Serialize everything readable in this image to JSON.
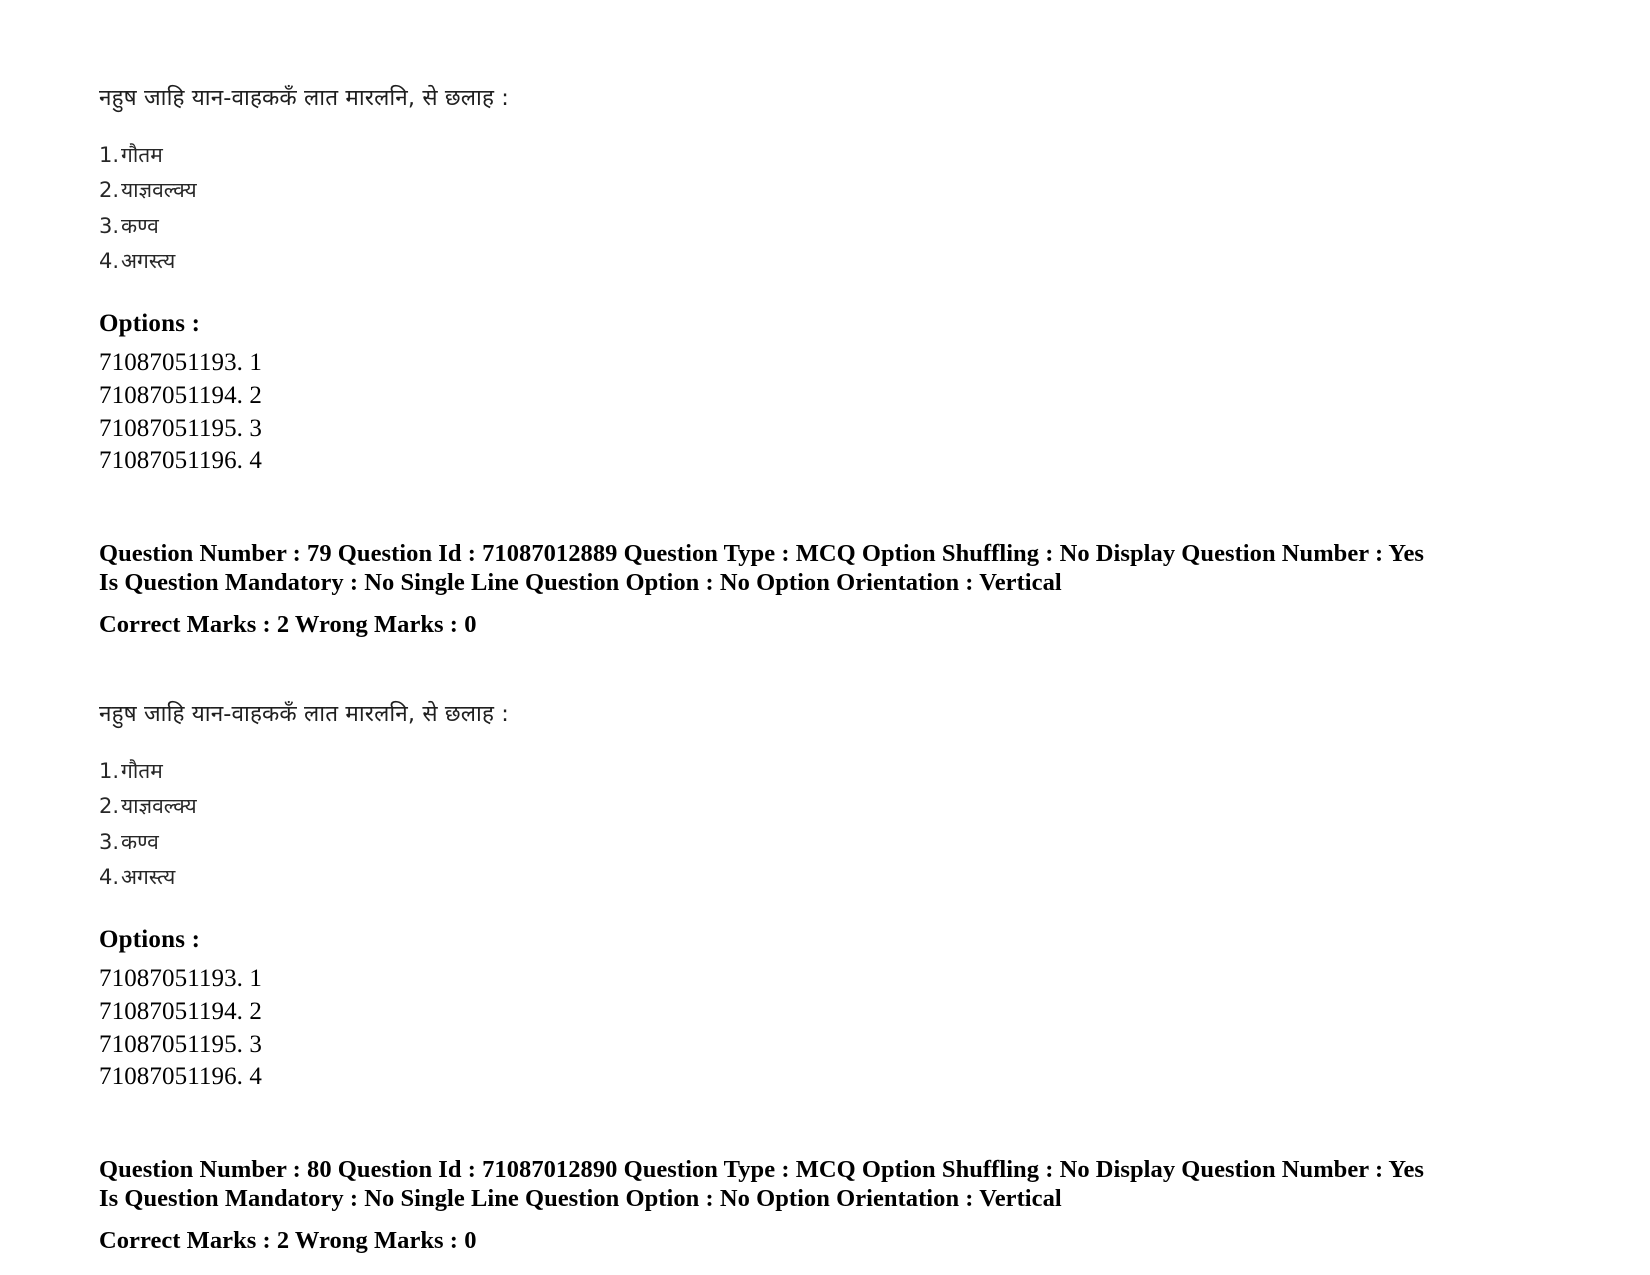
{
  "document": {
    "type": "exam-question-paper",
    "background_color": "#ffffff",
    "text_color": "#000000"
  },
  "blocks": [
    {
      "question_stem": "नहुष जाहि यान-वाहककॅं लात मारलनि, से छलाह :",
      "choices": [
        {
          "num": "1.",
          "text": "गौतम"
        },
        {
          "num": "2.",
          "text": "याज्ञवल्क्य"
        },
        {
          "num": "3.",
          "text": "कण्व"
        },
        {
          "num": "4.",
          "text": "अगस्त्य"
        }
      ],
      "options_heading": "Options :",
      "option_rows": [
        "71087051193. 1",
        "71087051194. 2",
        "71087051195. 3",
        "71087051196. 4"
      ],
      "meta": {
        "line1": "Question Number : 79 Question Id : 71087012889 Question Type : MCQ Option Shuffling : No Display Question Number : Yes Is Question Mandatory : No Single Line Question Option : No Option Orientation : Vertical",
        "line2": "Correct Marks : 2 Wrong Marks : 0",
        "question_number": "79",
        "question_id": "71087012889",
        "question_type": "MCQ",
        "option_shuffling": "No",
        "display_question_number": "Yes",
        "is_question_mandatory": "No",
        "single_line_question_option": "No",
        "option_orientation": "Vertical",
        "correct_marks": "2",
        "wrong_marks": "0"
      }
    },
    {
      "question_stem": "नहुष जाहि यान-वाहककॅं लात मारलनि, से छलाह :",
      "choices": [
        {
          "num": "1.",
          "text": "गौतम"
        },
        {
          "num": "2.",
          "text": "याज्ञवल्क्य"
        },
        {
          "num": "3.",
          "text": "कण्व"
        },
        {
          "num": "4.",
          "text": "अगस्त्य"
        }
      ],
      "options_heading": "Options :",
      "option_rows": [
        "71087051193. 1",
        "71087051194. 2",
        "71087051195. 3",
        "71087051196. 4"
      ],
      "meta": {
        "line1": "Question Number : 80 Question Id : 71087012890 Question Type : MCQ Option Shuffling : No Display Question Number : Yes Is Question Mandatory : No Single Line Question Option : No Option Orientation : Vertical",
        "line2": "Correct Marks : 2 Wrong Marks : 0",
        "question_number": "80",
        "question_id": "71087012890",
        "question_type": "MCQ",
        "option_shuffling": "No",
        "display_question_number": "Yes",
        "is_question_mandatory": "No",
        "single_line_question_option": "No",
        "option_orientation": "Vertical",
        "correct_marks": "2",
        "wrong_marks": "0"
      }
    }
  ]
}
